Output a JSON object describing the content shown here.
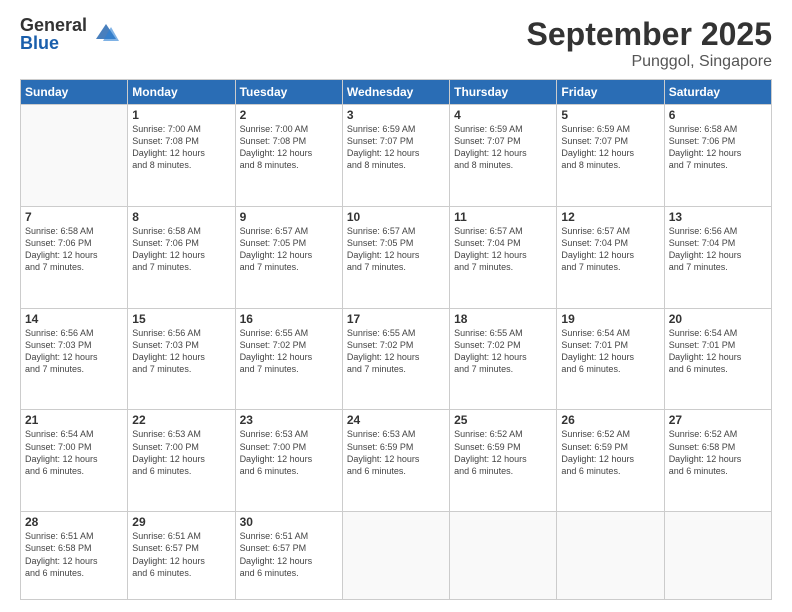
{
  "logo": {
    "general": "General",
    "blue": "Blue"
  },
  "header": {
    "month": "September 2025",
    "location": "Punggol, Singapore"
  },
  "weekdays": [
    "Sunday",
    "Monday",
    "Tuesday",
    "Wednesday",
    "Thursday",
    "Friday",
    "Saturday"
  ],
  "weeks": [
    [
      {
        "day": "",
        "info": ""
      },
      {
        "day": "1",
        "info": "Sunrise: 7:00 AM\nSunset: 7:08 PM\nDaylight: 12 hours\nand 8 minutes."
      },
      {
        "day": "2",
        "info": "Sunrise: 7:00 AM\nSunset: 7:08 PM\nDaylight: 12 hours\nand 8 minutes."
      },
      {
        "day": "3",
        "info": "Sunrise: 6:59 AM\nSunset: 7:07 PM\nDaylight: 12 hours\nand 8 minutes."
      },
      {
        "day": "4",
        "info": "Sunrise: 6:59 AM\nSunset: 7:07 PM\nDaylight: 12 hours\nand 8 minutes."
      },
      {
        "day": "5",
        "info": "Sunrise: 6:59 AM\nSunset: 7:07 PM\nDaylight: 12 hours\nand 8 minutes."
      },
      {
        "day": "6",
        "info": "Sunrise: 6:58 AM\nSunset: 7:06 PM\nDaylight: 12 hours\nand 7 minutes."
      }
    ],
    [
      {
        "day": "7",
        "info": "Sunrise: 6:58 AM\nSunset: 7:06 PM\nDaylight: 12 hours\nand 7 minutes."
      },
      {
        "day": "8",
        "info": "Sunrise: 6:58 AM\nSunset: 7:06 PM\nDaylight: 12 hours\nand 7 minutes."
      },
      {
        "day": "9",
        "info": "Sunrise: 6:57 AM\nSunset: 7:05 PM\nDaylight: 12 hours\nand 7 minutes."
      },
      {
        "day": "10",
        "info": "Sunrise: 6:57 AM\nSunset: 7:05 PM\nDaylight: 12 hours\nand 7 minutes."
      },
      {
        "day": "11",
        "info": "Sunrise: 6:57 AM\nSunset: 7:04 PM\nDaylight: 12 hours\nand 7 minutes."
      },
      {
        "day": "12",
        "info": "Sunrise: 6:57 AM\nSunset: 7:04 PM\nDaylight: 12 hours\nand 7 minutes."
      },
      {
        "day": "13",
        "info": "Sunrise: 6:56 AM\nSunset: 7:04 PM\nDaylight: 12 hours\nand 7 minutes."
      }
    ],
    [
      {
        "day": "14",
        "info": "Sunrise: 6:56 AM\nSunset: 7:03 PM\nDaylight: 12 hours\nand 7 minutes."
      },
      {
        "day": "15",
        "info": "Sunrise: 6:56 AM\nSunset: 7:03 PM\nDaylight: 12 hours\nand 7 minutes."
      },
      {
        "day": "16",
        "info": "Sunrise: 6:55 AM\nSunset: 7:02 PM\nDaylight: 12 hours\nand 7 minutes."
      },
      {
        "day": "17",
        "info": "Sunrise: 6:55 AM\nSunset: 7:02 PM\nDaylight: 12 hours\nand 7 minutes."
      },
      {
        "day": "18",
        "info": "Sunrise: 6:55 AM\nSunset: 7:02 PM\nDaylight: 12 hours\nand 7 minutes."
      },
      {
        "day": "19",
        "info": "Sunrise: 6:54 AM\nSunset: 7:01 PM\nDaylight: 12 hours\nand 6 minutes."
      },
      {
        "day": "20",
        "info": "Sunrise: 6:54 AM\nSunset: 7:01 PM\nDaylight: 12 hours\nand 6 minutes."
      }
    ],
    [
      {
        "day": "21",
        "info": "Sunrise: 6:54 AM\nSunset: 7:00 PM\nDaylight: 12 hours\nand 6 minutes."
      },
      {
        "day": "22",
        "info": "Sunrise: 6:53 AM\nSunset: 7:00 PM\nDaylight: 12 hours\nand 6 minutes."
      },
      {
        "day": "23",
        "info": "Sunrise: 6:53 AM\nSunset: 7:00 PM\nDaylight: 12 hours\nand 6 minutes."
      },
      {
        "day": "24",
        "info": "Sunrise: 6:53 AM\nSunset: 6:59 PM\nDaylight: 12 hours\nand 6 minutes."
      },
      {
        "day": "25",
        "info": "Sunrise: 6:52 AM\nSunset: 6:59 PM\nDaylight: 12 hours\nand 6 minutes."
      },
      {
        "day": "26",
        "info": "Sunrise: 6:52 AM\nSunset: 6:59 PM\nDaylight: 12 hours\nand 6 minutes."
      },
      {
        "day": "27",
        "info": "Sunrise: 6:52 AM\nSunset: 6:58 PM\nDaylight: 12 hours\nand 6 minutes."
      }
    ],
    [
      {
        "day": "28",
        "info": "Sunrise: 6:51 AM\nSunset: 6:58 PM\nDaylight: 12 hours\nand 6 minutes."
      },
      {
        "day": "29",
        "info": "Sunrise: 6:51 AM\nSunset: 6:57 PM\nDaylight: 12 hours\nand 6 minutes."
      },
      {
        "day": "30",
        "info": "Sunrise: 6:51 AM\nSunset: 6:57 PM\nDaylight: 12 hours\nand 6 minutes."
      },
      {
        "day": "",
        "info": ""
      },
      {
        "day": "",
        "info": ""
      },
      {
        "day": "",
        "info": ""
      },
      {
        "day": "",
        "info": ""
      }
    ]
  ]
}
